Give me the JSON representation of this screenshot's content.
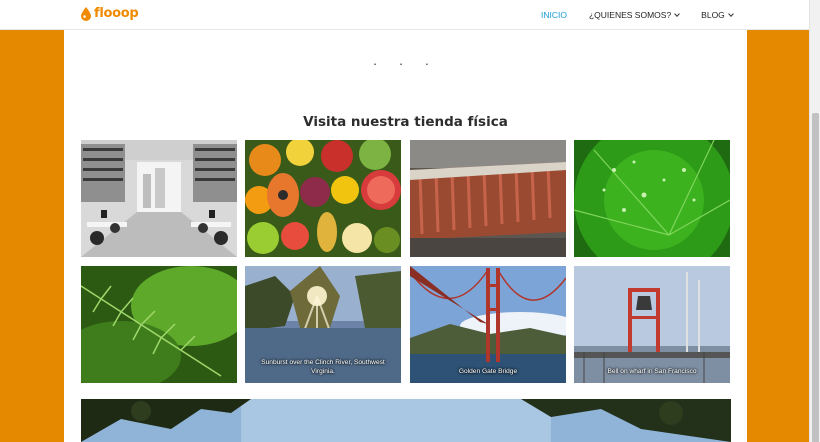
{
  "header": {
    "logo_text": "flooop",
    "nav": [
      {
        "label": "INICIO",
        "active": true,
        "dropdown": false
      },
      {
        "label": "¿QUIENES SOMOS?",
        "active": false,
        "dropdown": true
      },
      {
        "label": "BLOG",
        "active": false,
        "dropdown": true
      }
    ]
  },
  "main": {
    "separator_dots": "· · ·",
    "section_title": "Visita nuestra tienda física",
    "gallery": [
      {
        "image": "office-room-photo",
        "caption": ""
      },
      {
        "image": "tropical-fruits-photo",
        "caption": ""
      },
      {
        "image": "tree-bark-photo",
        "caption": ""
      },
      {
        "image": "leaf-water-drops-photo",
        "caption": ""
      },
      {
        "image": "fern-leaves-photo",
        "caption": ""
      },
      {
        "image": "sunburst-river-photo",
        "caption": "Sunburst over the Clinch River, Southwest Virginia."
      },
      {
        "image": "golden-gate-bridge-photo",
        "caption": "Golden Gate Bridge"
      },
      {
        "image": "bell-on-wharf-photo",
        "caption": "Bell on wharf in San Francisco"
      }
    ],
    "banner_image": "trees-sky-photo"
  },
  "colors": {
    "accent_orange": "#e58a00",
    "nav_active": "#1a9bd7"
  }
}
